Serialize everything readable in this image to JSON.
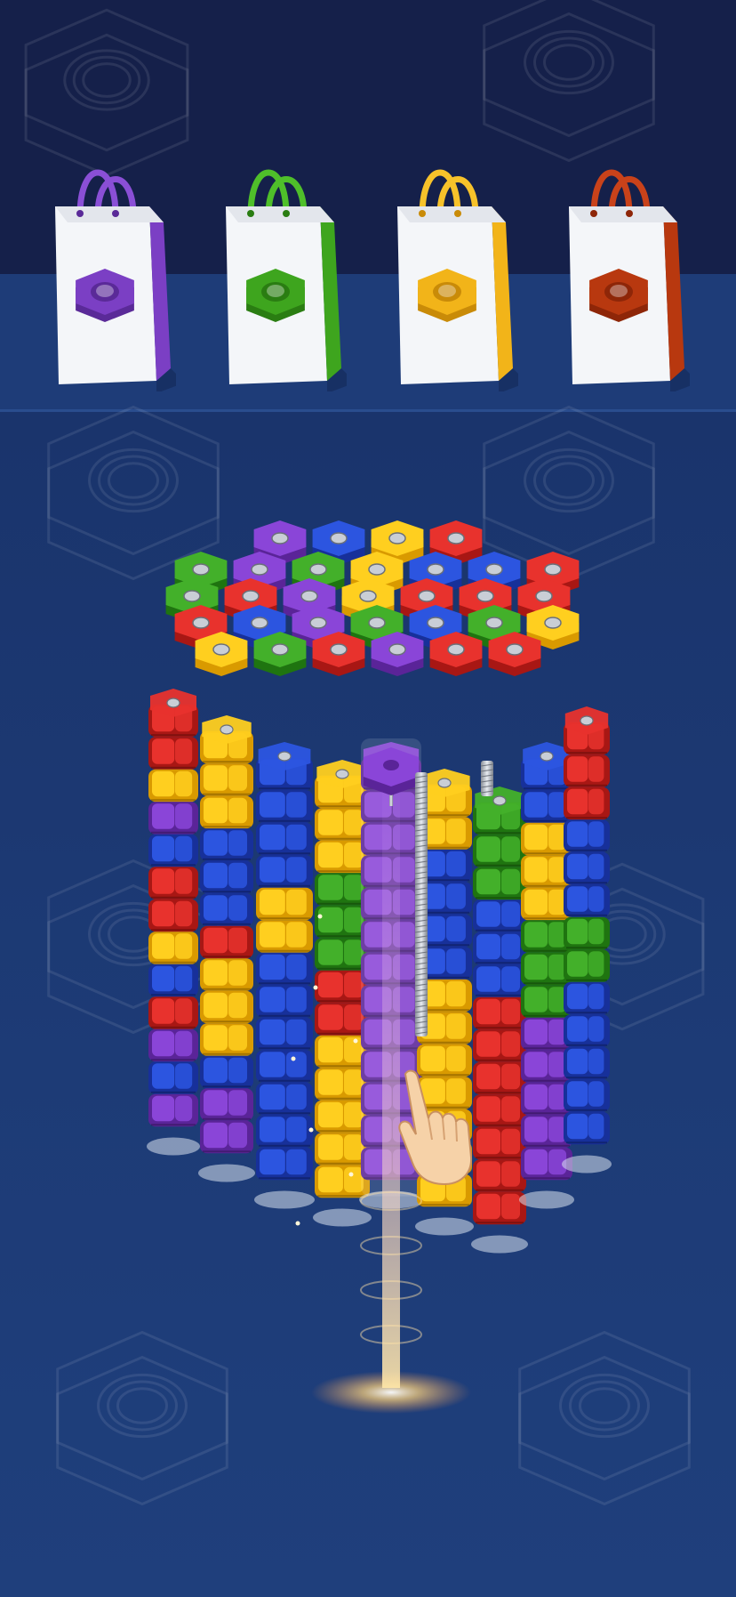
{
  "shopping_bags": [
    {
      "color_name": "purple",
      "body": "#ffffff",
      "accent": "#7b3fc4",
      "accent_dark": "#5a2a98",
      "handle": "#8a4fd6",
      "icon": "hex-nut-icon"
    },
    {
      "color_name": "green",
      "body": "#ffffff",
      "accent": "#3ea51e",
      "accent_dark": "#2a7d12",
      "handle": "#4fbf2a",
      "icon": "hex-nut-icon"
    },
    {
      "color_name": "yellow",
      "body": "#ffffff",
      "accent": "#f2b419",
      "accent_dark": "#c98b08",
      "handle": "#f7c22a",
      "icon": "hex-nut-icon"
    },
    {
      "color_name": "red",
      "body": "#ffffff",
      "accent": "#b8380f",
      "accent_dark": "#8e2608",
      "handle": "#c9421a",
      "icon": "hex-nut-icon"
    }
  ],
  "nut_colors": {
    "red": [
      "#e8322d",
      "#a81714"
    ],
    "blue": [
      "#2c55e0",
      "#17309a"
    ],
    "yellow": [
      "#ffcf1f",
      "#d99a00"
    ],
    "green": [
      "#43b02a",
      "#1f7410"
    ],
    "purple": [
      "#8a45d8",
      "#5a2498"
    ]
  },
  "tower": {
    "top_caps": [
      [
        "purple",
        "blue",
        "yellow",
        "red"
      ],
      [
        "green",
        "purple",
        "green",
        "yellow",
        "blue",
        "blue",
        "red"
      ],
      [
        "green",
        "red",
        "purple",
        "yellow",
        "red",
        "red",
        "red"
      ],
      [
        "red",
        "blue",
        "purple",
        "green",
        "blue",
        "green",
        "yellow"
      ],
      [
        "yellow",
        "green",
        "red",
        "purple",
        "red",
        "red"
      ]
    ],
    "columns": [
      [
        "red",
        "red",
        "yellow",
        "purple",
        "blue",
        "red",
        "red",
        "yellow",
        "blue",
        "red",
        "purple",
        "blue",
        "purple"
      ],
      [
        "yellow",
        "yellow",
        "yellow",
        "blue",
        "blue",
        "blue",
        "red",
        "yellow",
        "yellow",
        "yellow",
        "blue",
        "purple",
        "purple"
      ],
      [
        "blue",
        "blue",
        "blue",
        "blue",
        "yellow",
        "yellow",
        "blue",
        "blue",
        "blue",
        "blue",
        "blue",
        "blue",
        "blue"
      ],
      [
        "yellow",
        "yellow",
        "yellow",
        "green",
        "green",
        "green",
        "red",
        "red",
        "yellow",
        "yellow",
        "yellow",
        "yellow",
        "yellow"
      ],
      [
        "purple",
        "purple",
        "purple",
        "purple",
        "purple",
        "purple",
        "purple",
        "purple",
        "purple",
        "purple",
        "purple",
        "purple",
        "purple"
      ],
      [
        "yellow",
        "yellow",
        "blue",
        "blue",
        "blue",
        "blue",
        "yellow",
        "yellow",
        "yellow",
        "yellow",
        "yellow",
        "yellow",
        "yellow"
      ],
      [
        "green",
        "green",
        "green",
        "blue",
        "blue",
        "blue",
        "red",
        "red",
        "red",
        "red",
        "red",
        "red",
        "red"
      ],
      [
        "blue",
        "blue",
        "yellow",
        "yellow",
        "yellow",
        "green",
        "green",
        "green",
        "purple",
        "purple",
        "purple",
        "purple",
        "purple"
      ],
      [
        "red",
        "red",
        "red",
        "blue",
        "blue",
        "blue",
        "green",
        "green",
        "blue",
        "blue",
        "blue",
        "blue",
        "blue"
      ]
    ],
    "active_column": 4,
    "selected_nut": "purple"
  },
  "hint_hand_icon": "pointing-hand-icon"
}
